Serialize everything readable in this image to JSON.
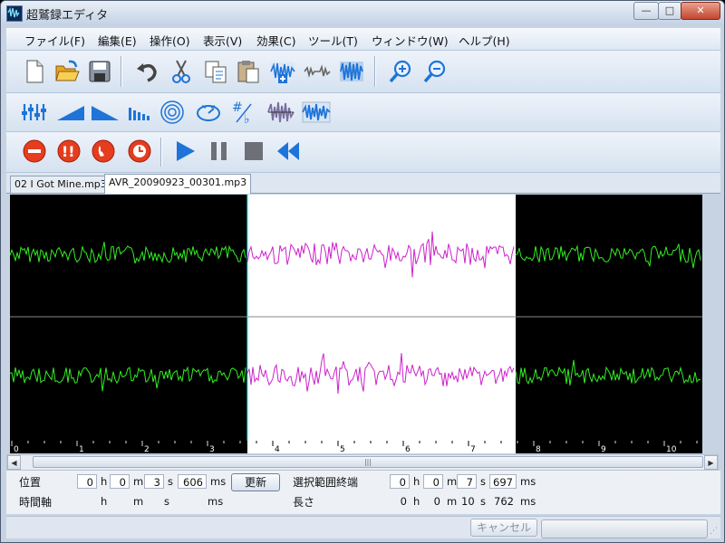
{
  "app": {
    "title": "超鷲録エディタ",
    "icon": "waveform-app-icon"
  },
  "window_controls": {
    "minimize": "—",
    "maximize": "□",
    "close": "✕"
  },
  "menu": [
    "ファイル(F)",
    "編集(E)",
    "操作(O)",
    "表示(V)",
    "効果(C)",
    "ツール(T)",
    "ウィンドウ(W)",
    "ヘルプ(H)"
  ],
  "toolbar1": [
    "new-file-icon",
    "open-folder-icon",
    "save-icon",
    "undo-icon",
    "cut-icon",
    "copy-icon",
    "paste-icon",
    "insert-audio-icon",
    "trim-audio-icon",
    "split-channel-icon",
    "zoom-in-icon",
    "zoom-out-icon"
  ],
  "toolbar2": [
    "equalizer-icon",
    "fade-in-icon",
    "fade-out-icon",
    "envelope-icon",
    "echo-icon",
    "speed-icon",
    "pitch-icon",
    "normalize-icon",
    "reverse-wave-icon"
  ],
  "toolbar3": [
    "record-icon",
    "record-now-icon",
    "phone-record-icon",
    "timer-record-icon",
    "play-icon",
    "pause-icon",
    "stop-icon",
    "rewind-icon"
  ],
  "tabs": [
    {
      "label": "02 I Got Mine.mp3",
      "active": false
    },
    {
      "label": "AVR_20090923_00301.mp3",
      "active": true
    }
  ],
  "timeline": {
    "ticks": [
      "0",
      "1",
      "2",
      "3",
      "4",
      "5",
      "6",
      "7",
      "8",
      "9",
      "10"
    ]
  },
  "status": {
    "position_label": "位置",
    "timeaxis_label": "時間軸",
    "position": {
      "h": "0",
      "m": "0",
      "s": "3",
      "ms": "606"
    },
    "units": {
      "h": "h",
      "m": "m",
      "s": "s",
      "ms": "ms"
    },
    "update_button": "更新",
    "selection_end_label": "選択範囲終端",
    "selection_end": {
      "h": "0",
      "m": "0",
      "s": "7",
      "ms": "697"
    },
    "length_label": "長さ",
    "length": {
      "h": "0",
      "m": "0",
      "s": "10",
      "ms": "762"
    }
  },
  "bottom": {
    "cancel_button": "キャンセル"
  },
  "colors": {
    "wave_normal": "#33ee22",
    "wave_selected": "#cc22cc",
    "selection_bg": "#ffffff",
    "cursor": "#00ffff"
  }
}
